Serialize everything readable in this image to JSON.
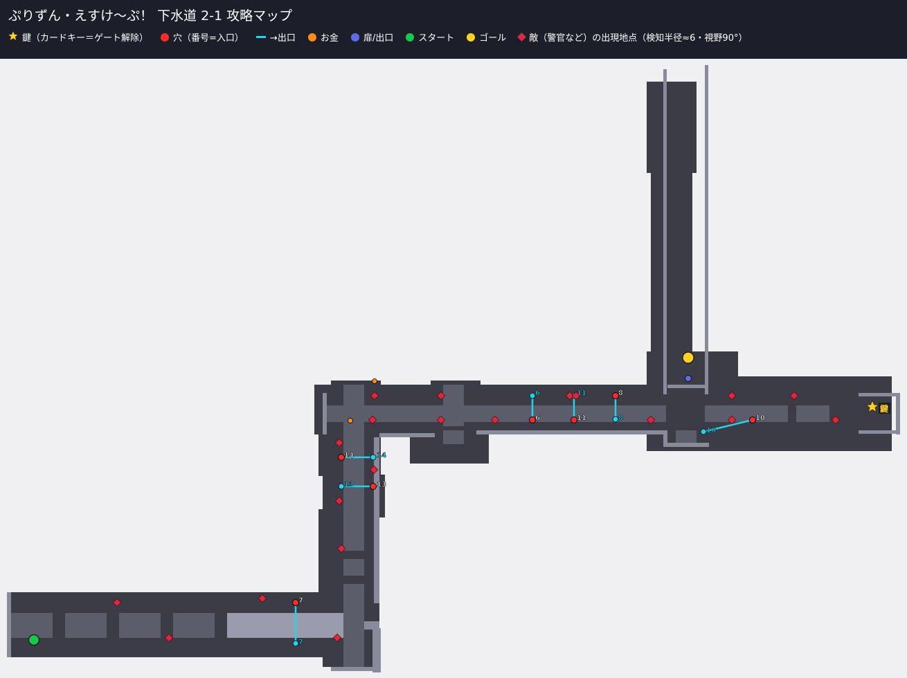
{
  "title": "ぷりずん・えすけ～ぷ！ 下水道 2-1 攻略マップ",
  "legend": [
    {
      "symbol": "star",
      "color": "#ffd21f",
      "text": "鍵（カードキー＝ゲート解除）"
    },
    {
      "symbol": "dot",
      "color": "#ff2a2a",
      "text": "穴（番号=入口）"
    },
    {
      "symbol": "dash",
      "color": "#22d3ee",
      "text": "→出口"
    },
    {
      "symbol": "dot",
      "color": "#ff8c12",
      "text": "お金"
    },
    {
      "symbol": "dot",
      "color": "#5a6cf0",
      "text": "扉/出口"
    },
    {
      "symbol": "dot",
      "color": "#16c94a",
      "text": "スタート"
    },
    {
      "symbol": "dot",
      "color": "#ffd21f",
      "text": "ゴール"
    },
    {
      "symbol": "diamond",
      "color": "#e0283c",
      "text": "敵（警官など）の出現地点（検知半径≈6・視野90°）"
    }
  ],
  "key_marker_label": "鍵",
  "holes": [
    {
      "num": "6"
    },
    {
      "num": "11"
    },
    {
      "num": "8"
    },
    {
      "num": "10"
    },
    {
      "num": "14"
    },
    {
      "num": "13"
    },
    {
      "num": "7"
    }
  ],
  "colors": {
    "header_bg": "#1c1f29",
    "background": "#f0f0f2",
    "wall": "#3b3c46",
    "floor": "#5b5d6b",
    "lit_floor": "#9a9bac",
    "edge": "#8a8b9a",
    "hole": "#ff2a2a",
    "exit": "#22d3ee",
    "enemy": "#e0283c",
    "money": "#ff8c12",
    "door": "#5a6cf0",
    "start": "#16c94a",
    "goal": "#ffd21f",
    "key": "#ffd21f"
  }
}
